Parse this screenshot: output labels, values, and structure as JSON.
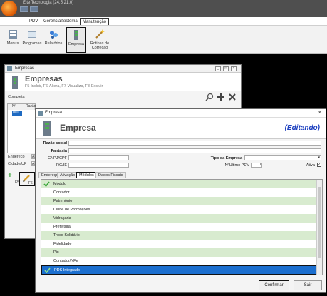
{
  "app": {
    "title": "Eite Tecnologia (24.5.21.0)"
  },
  "menu": {
    "items": [
      "PDV",
      "Gerencial",
      "Sistema",
      "Manutenção"
    ]
  },
  "ribbon": {
    "buttons": [
      "Menus",
      "Programas",
      "Relatórios",
      "Empresa",
      "Rotinas de\nCorreção"
    ]
  },
  "empresas_window": {
    "title": "Empresas",
    "heading": "Empresas",
    "shortcuts": "F5-Incluir, F6-Altera, F7-Visualiza, F8-Excluir",
    "toolbar_label": "Completa",
    "grid_header_n": "Nº",
    "grid_header_razao": "Razão",
    "grid_selected": "001",
    "side_labels": [
      "Endereço",
      "Cidade/UF"
    ],
    "side_values": [
      "Al",
      "Al"
    ],
    "footer_keys": [
      "F5",
      "F6"
    ]
  },
  "dialog": {
    "title": "Empresa",
    "heading": "Empresa",
    "status": "(Editando)",
    "labels": {
      "razao": "Razão social",
      "fantasia": "Fantasia",
      "cnpj": "CNPJ/CPF",
      "rgie": "RG/IE",
      "tipo": "Tipo da Empresa",
      "ultimo_pdv": "NºUltimo PDV",
      "ativa": "Ativa"
    },
    "values": {
      "ultimo_pdv": "0",
      "ativa_checked": "✓"
    },
    "tabs": [
      "Endereço",
      "Ativação",
      "Módulos",
      "Dados Fiscais"
    ],
    "active_tab": 2,
    "modules": [
      {
        "label": "Módulo",
        "checked": true
      },
      {
        "label": "Contador",
        "checked": false
      },
      {
        "label": "Patrimônio",
        "checked": false
      },
      {
        "label": "Clube de Promoções",
        "checked": false
      },
      {
        "label": "Vidraçaria",
        "checked": false
      },
      {
        "label": "Prefeitura",
        "checked": false
      },
      {
        "label": "Troco Solidário",
        "checked": false
      },
      {
        "label": "Fidelidade",
        "checked": false
      },
      {
        "label": "Pix",
        "checked": false
      },
      {
        "label": "Contador/NFe",
        "checked": false
      },
      {
        "label": "PDS Integrado",
        "checked": true,
        "selected": true
      }
    ],
    "buttons": {
      "confirm": "Confirmar",
      "exit": "Sair"
    }
  },
  "colors": {
    "accent": "#1c6fcf",
    "row_green": "#d8ebcf",
    "status_blue": "#1c3fbf"
  }
}
